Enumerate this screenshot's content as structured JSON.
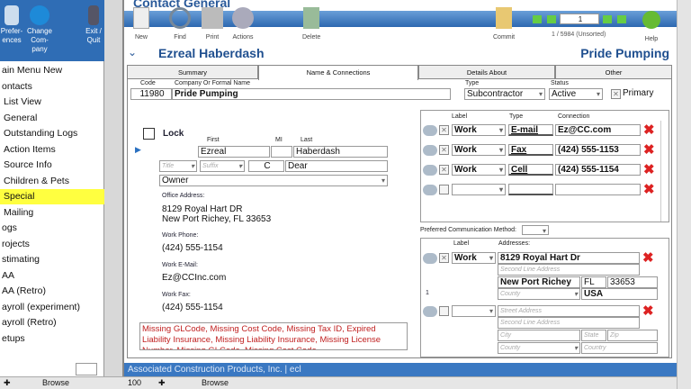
{
  "sidebar": {
    "buttons": [
      {
        "label": "Prefer-\nences"
      },
      {
        "label": "Change\nCom-\npany"
      },
      {
        "label": "Exit /\nQuit"
      }
    ],
    "items": [
      "ain Menu New",
      "ontacts",
      "List View",
      "General",
      "Outstanding Logs",
      "Action Items",
      "Source Info",
      "Children & Pets",
      "Special",
      "Mailing",
      "ogs",
      "rojects",
      "stimating",
      "AA",
      "AA (Retro)",
      "ayroll (experiment)",
      "ayroll (Retro)",
      "etups"
    ],
    "selected": "Special"
  },
  "header": {
    "title": "Contact General",
    "contact_name": "Ezreal Haberdash",
    "company": "Pride Pumping"
  },
  "toolbar": {
    "new": "New",
    "find": "Find",
    "print": "Print",
    "actions": "Actions",
    "delete": "Delete",
    "commit": "Commit",
    "help": "Help",
    "record_input": "1",
    "record_count": "1 / 5984 (Unsorted)"
  },
  "tabs": [
    "Summary",
    "Name & Connections",
    "Details About",
    "Other"
  ],
  "form": {
    "code_label": "Code",
    "code": "11980",
    "company_label": "Company Or Formal Name",
    "company": "Pride Pumping",
    "type_label": "Type",
    "type": "Subcontractor",
    "status_label": "Status",
    "status": "Active",
    "primary": "Primary",
    "lock": "Lock",
    "first_label": "First",
    "mi_label": "MI",
    "last_label": "Last",
    "first": "Ezreal",
    "mi": "",
    "last": "Haberdash",
    "title_ph": "Title",
    "suffix_ph": "Suffix",
    "initial": "C",
    "salutation": "Dear",
    "role": "Owner",
    "office_address_label": "Office Address:",
    "address1": "8129 Royal Hart DR",
    "address2": "New Port Richey, FL  33653",
    "work_phone_label": "Work Phone:",
    "work_phone": "(424) 555-1154",
    "work_email_label": "Work E-Mail:",
    "work_email": "Ez@CCInc.com",
    "work_fax_label": "Work Fax:",
    "work_fax": "(424) 555-1154",
    "warnings": "Missing GLCode, Missing Cost Code, Missing Tax ID, Expired Liability Insurance, Missing Liability Insurance, Missing License Number, Missing GLCode, Missing Cost Code"
  },
  "connections": {
    "headers": [
      "Label",
      "Type",
      "Connection"
    ],
    "rows": [
      {
        "label": "Work",
        "type": "E-mail",
        "value": "Ez@CC.com"
      },
      {
        "label": "Work",
        "type": "Fax",
        "value": "(424) 555-1153"
      },
      {
        "label": "Work",
        "type": "Cell",
        "value": "(424) 555-1154"
      },
      {
        "label": "",
        "type": "",
        "value": ""
      }
    ],
    "preferred_label": "Preferred Communication Method:"
  },
  "addresses": {
    "headers": [
      "Label",
      "Addresses:"
    ],
    "row_number": "1",
    "rows": [
      {
        "label": "Work",
        "street": "8129 Royal Hart Dr",
        "street2_ph": "Second Line Address",
        "city": "New Port Richey",
        "state": "FL",
        "zip": "33653",
        "county_ph": "County",
        "country": "USA"
      },
      {
        "label": "",
        "street_ph": "Street Address",
        "street2_ph": "Second Line Address",
        "city_ph": "City",
        "state_ph": "State",
        "zip_ph": "Zip",
        "county_ph": "County",
        "country_ph": "Country"
      }
    ]
  },
  "status_bar": "Associated Construction Products, Inc. | ecl",
  "bottom": {
    "zoom": "100",
    "mode_left": "Browse",
    "mode_right": "Browse"
  }
}
